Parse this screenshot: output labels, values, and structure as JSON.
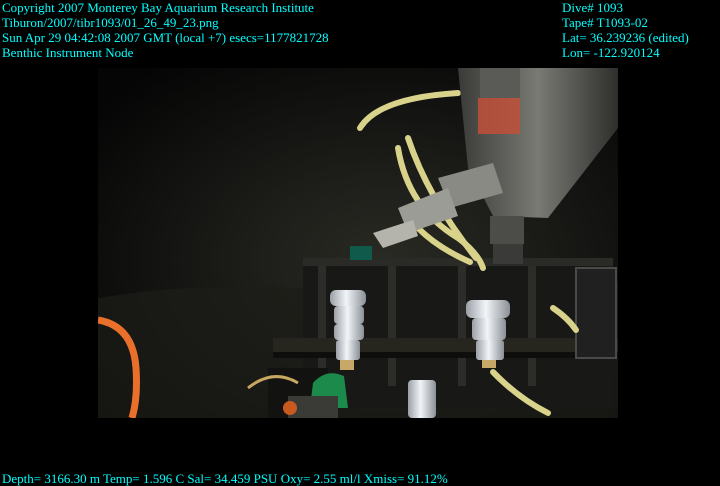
{
  "header_left": {
    "line1": "Copyright 2007 Monterey Bay Aquarium Research Institute",
    "line2": "Tiburon/2007/tibr1093/01_26_49_23.png",
    "line3": "Sun Apr 29 04:42:08 2007 GMT (local +7)  esecs=1177821728",
    "line4": "Benthic Instrument Node"
  },
  "header_right": {
    "dive": "Dive# 1093",
    "tape": "Tape# T1093-02",
    "lat": "Lat= 36.239236 (edited)",
    "lon": "Lon= -122.920124"
  },
  "footer": {
    "telemetry": "Depth= 3166.30 m  Temp= 1.596 C  Sal= 34.459 PSU  Oxy= 2.55 ml/l  Xmiss= 91.12%"
  },
  "colors": {
    "overlay_text": "#00ffff",
    "background": "#000000",
    "cable_yellow": "#d8d28a",
    "hose_orange": "#e8702a",
    "connector_white": "#e8ecf0",
    "metal_gray": "#6a6a66"
  }
}
